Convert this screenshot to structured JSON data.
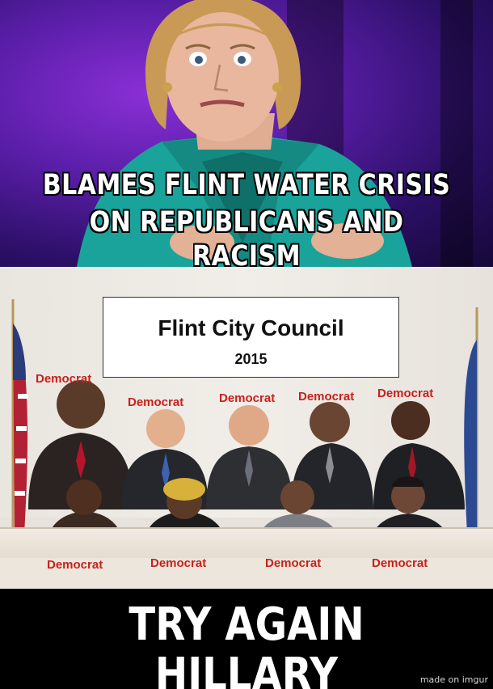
{
  "top_caption": {
    "line1": "BLAMES FLINT WATER CRISIS",
    "line2": "ON REPUBLICANS AND RACISM"
  },
  "council_sign": {
    "title": "Flint City Council",
    "year": "2015"
  },
  "member_labels": {
    "back_row": [
      "Democrat",
      "Democrat",
      "Democrat",
      "Democrat",
      "Democrat"
    ],
    "front_row": [
      "Democrat",
      "Democrat",
      "Democrat",
      "Democrat"
    ]
  },
  "bottom_caption": "TRY AGAIN HILLARY",
  "watermark": "made on imgur",
  "colors": {
    "label_red": "#c8211b",
    "caption_white": "#ffffff",
    "stage_purple": "#5a1ea8",
    "jacket_teal": "#1aa39a"
  }
}
